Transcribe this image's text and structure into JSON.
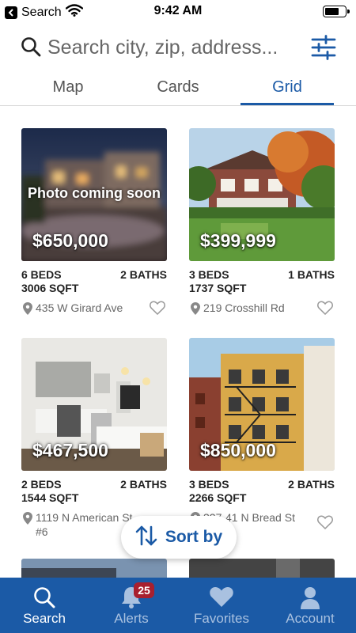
{
  "status_bar": {
    "carrier": "Search",
    "time": "9:42 AM",
    "battery_level": 0.75
  },
  "search": {
    "placeholder": "Search city, zip, address..."
  },
  "tabs": [
    {
      "label": "Map",
      "active": false
    },
    {
      "label": "Cards",
      "active": false
    },
    {
      "label": "Grid",
      "active": true
    }
  ],
  "listings": [
    {
      "price": "$650,000",
      "overlay": "Photo coming soon",
      "beds": "6 BEDS",
      "baths": "2 BATHS",
      "sqft": "3006 SQFT",
      "address": "435 W Girard Ave",
      "photo": "blurred-night-house"
    },
    {
      "price": "$399,999",
      "overlay": "",
      "beds": "3 BEDS",
      "baths": "1 BATHS",
      "sqft": "1737 SQFT",
      "address": "219 Crosshill Rd",
      "photo": "brick-house-with-tree"
    },
    {
      "price": "$467,500",
      "overlay": "",
      "beds": "2 BEDS",
      "baths": "2 BATHS",
      "sqft": "1544 SQFT",
      "address": "1119 N American St #6",
      "photo": "modern-kitchen"
    },
    {
      "price": "$850,000",
      "overlay": "",
      "beds": "3 BEDS",
      "baths": "2 BATHS",
      "sqft": "2266 SQFT",
      "address": "327-41 N Bread St",
      "photo": "fire-escape-building"
    }
  ],
  "sort": {
    "label": "Sort by"
  },
  "nav": [
    {
      "label": "Search",
      "icon": "search-icon",
      "active": true
    },
    {
      "label": "Alerts",
      "icon": "bell-icon",
      "badge": "25",
      "active": false
    },
    {
      "label": "Favorites",
      "icon": "heart-icon",
      "active": false
    },
    {
      "label": "Account",
      "icon": "person-icon",
      "active": false
    }
  ],
  "colors": {
    "brand": "#1b5aa6",
    "badge": "#a8202f",
    "nav_inactive": "#a9c1e0"
  }
}
